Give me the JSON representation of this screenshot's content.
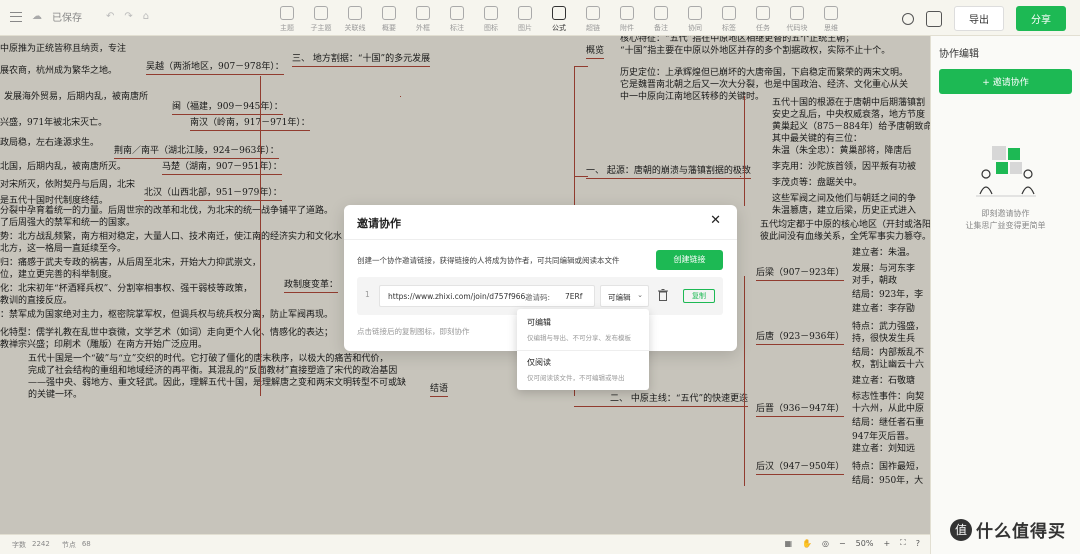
{
  "topbar": {
    "save_status": "已保存",
    "tools": [
      "主题",
      "子主题",
      "关联线",
      "概要",
      "外框",
      "标注",
      "图标",
      "图片",
      "公式",
      "超链",
      "附件",
      "备注",
      "协同",
      "标签",
      "任务",
      "代码块",
      "思维"
    ],
    "export_label": "导出",
    "share_label": "分享"
  },
  "right_panel": {
    "title": "协作编辑",
    "invite_label": "+ 邀请协作",
    "empty_line1": "即刻邀请协作",
    "empty_line2": "让集思广益变得更简单"
  },
  "status": {
    "words_label": "字数",
    "words": "2242",
    "nodes_label": "节点",
    "nodes": "68",
    "zoom": "50%"
  },
  "modal": {
    "title": "邀请协作",
    "description": "创建一个协作邀请链接，获得链接的人将成为协作者，可共同编辑或阅读本文件",
    "create_label": "创建链接",
    "index": "1",
    "url": "https://www.zhixi.com/join/d757f966",
    "code_label": "邀请码:",
    "code": "7ERf",
    "permission": "可编辑",
    "copy_label": "复制",
    "note": "点击链接后的复制图标，即刻协作"
  },
  "dropdown": {
    "options": [
      {
        "name": "可编辑",
        "desc": "仅编辑与导出、不可分享、发布模板"
      },
      {
        "name": "仅阅读",
        "desc": "仅可阅读该文件，不可编辑或导出"
      }
    ]
  },
  "mindmap": {
    "left": [
      "中原推为正统皆称且纳贡，专注",
      "展农商，杭州成为繁华之地。",
      "吴越（两浙地区，907－978年）：",
      "三、 地方割据：“十国”的多元发展",
      "发展海外贸易，后期内乱，被南唐所",
      "闽（福建，909－945年）：",
      "兴盛，971年被北宋灭亡。",
      "南汉（岭南，917－971年）：",
      "政局稳，左右逢源求生。",
      "荆南／南平（湖北江陵，924－963年）：",
      "北国，后期内乱，被南唐所灭。",
      "马楚（湖南，907－951年）：",
      "对宋所灭，依附契丹与后周，北宋",
      "北汉（山西北部，951－979年）：",
      "是五代十国时代制度终结。",
      "分裂中孕育着统一的力量。后周世宗的改革和北伐，为北宋的统一战争铺平了道路。",
      "了后周强大的禁军和统一的国家。",
      "势：北方战乱频繁，南方相对稳定，大量人口、技术南迁，使江南的经济实力和文化水",
      "北方，这一格局一直延续至今。",
      "归：痛感于武夫专政的祸害，从后周至北宋，开始大力抑武崇文，",
      "位，建立更完善的科举制度。",
      "化：北宋初年“杯酒释兵权”、分割宰相事权、强干弱枝等政策，",
      "政制度变革：",
      "教训的直接反应。",
      "：禁军成为国家绝对主力，枢密院掌军权，但调兵权与统兵权分离，防止军阀再现。",
      "化特型：儒学礼教在乱世中衰微，文学艺术（如词）走向更个人化、情感化的表达；",
      "教禅宗兴盛；印刷术（雕版）在南方开始广泛应用。",
      "五代十国是一个“破”与“立”交织的时代。它打破了僵化的唐末秩序，以极大的痛苦和代价，",
      "完成了社会结构的重组和地域经济的再平衡。其混乱的“反面教材”直接塑造了宋代的政治基因",
      "——强中央、弱地方、重文轻武。因此，理解五代十国，是理解唐之变和两宋文明转型不可或缺",
      "的关键一环。",
      "结语"
    ],
    "right": [
      "核心特征：“五代”指在中原地区相继更替的五个正统王朝；",
      "“十国”指主要在中原以外地区并存的多个割据政权，实际不止十个。",
      "概览",
      "历史定位：上承辉煌但已崩坏的大唐帝国，下启稳定而繁荣的两宋文明。",
      "它是魏晋南北朝之后又一次大分裂，也是中国政治、经济、文化重心从关",
      "中一中原向江南地区转移的关键时。",
      "五代十国的根源在于唐朝中后期藩镇割",
      "安史之乱后，中央权威衰落，地方节度",
      "黄巢起义（875－884年）给予唐朝致命一",
      "其中最关键的有三位：",
      "一、 起源：唐朝的崩溃与藩镇割据的极致",
      "朱温（朱全忠）：黄巢部将，降唐后",
      "李克用：沙陀族首领，因平叛有功被",
      "李茂贞等：盘踞关中。",
      "这些军阀之间及他们与朝廷之间的争",
      "朱温篡唐，建立后梁，历史正式进入",
      "五代均定都于中原的核心地区（开封或洛阳",
      "彼此间没有血缘关系，全凭军事实力篡夺。",
      "建立者：朱温。",
      "后梁（907－923年）",
      "发展：与河东李",
      "对手，朝政",
      "结局：923年，李",
      "建立者：李存勖",
      "后唐（923－936年）",
      "特点：武力强盛，",
      "持，很快发生兵",
      "结局：内部叛乱不",
      "权，割让幽云十六",
      "二、 中原主线：“五代”的快速更迭",
      "建立者：石敬瑭",
      "标志性事件：向契",
      "后晋（936－947年）",
      "十六州，从此中原",
      "结局：继任者石重",
      "947年灭后晋。",
      "建立者：刘知远",
      "后汉（947－950年）",
      "特点：国祚最短，",
      "结局：950年，大"
    ]
  }
}
